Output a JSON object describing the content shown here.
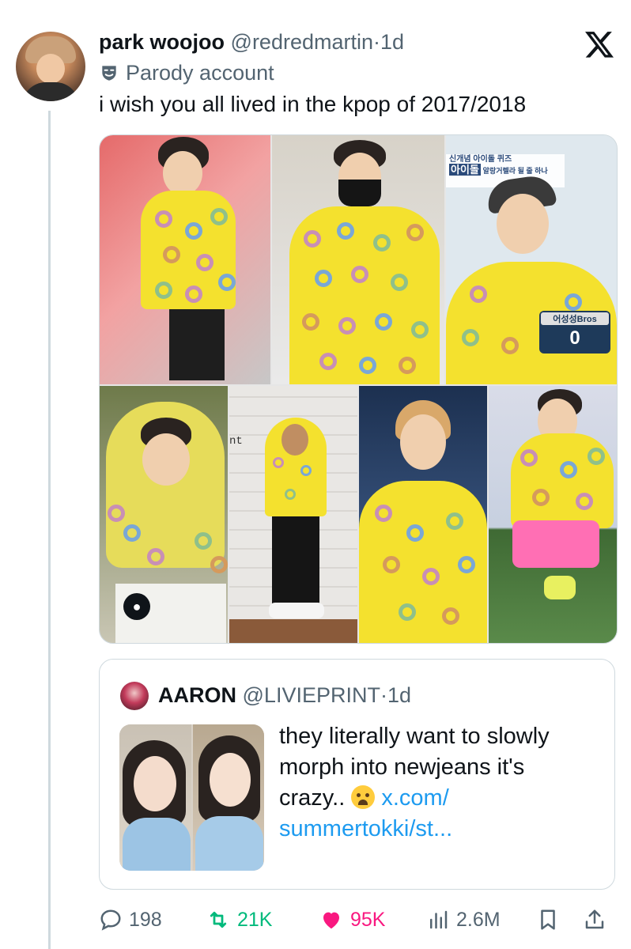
{
  "tweet": {
    "display_name": "park woojoo",
    "handle": "@redredmartin",
    "separator": "·",
    "time": "1d",
    "parody_label": "Parody account",
    "text": "i wish you all lived in the kpop of 2017/2018",
    "icons": [
      "x-logo-icon",
      "parody-mask-icon"
    ]
  },
  "collage": {
    "overlay_caption_line1": "신개념 아이돌 퀴즈",
    "overlay_caption_line2": "아이돌",
    "overlay_caption_line3": "알랑거렐라 될 줄 하나",
    "badge_label": "어성성Bros",
    "badge_score": "0",
    "wall_text": "nt"
  },
  "quote": {
    "display_name": "AARON",
    "handle": "@LIVIEPRINT",
    "separator": "·",
    "time": "1d",
    "text_line1": "they literally want to slowly",
    "text_line2": "morph into newjeans it's",
    "text_line3_prefix": "crazy..",
    "emoji": "loudly-crying-face",
    "link_line1": "x.com/",
    "link_line2": "summertokki/st..."
  },
  "actions": {
    "replies": "198",
    "reposts": "21K",
    "likes": "95K",
    "views": "2.6M"
  },
  "colors": {
    "accent": "#1d9bf0",
    "repost": "#00ba7c",
    "like": "#f91880",
    "muted": "#536471",
    "hoodie": "#f4e12e"
  }
}
